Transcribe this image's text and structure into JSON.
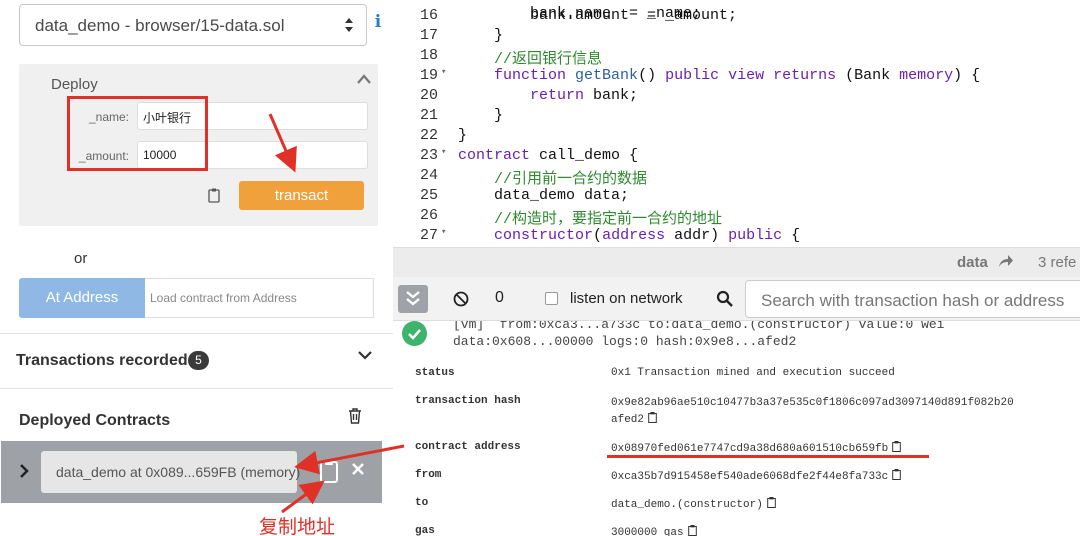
{
  "left": {
    "contract_select": "data_demo - browser/15-data.sol",
    "deploy": {
      "title": "Deploy",
      "fields": [
        {
          "label": "_name:",
          "value": "小叶银行"
        },
        {
          "label": "_amount:",
          "value": "10000"
        }
      ],
      "transact_label": "transact"
    },
    "or_label": "or",
    "at_address": {
      "button": "At Address",
      "placeholder": "Load contract from Address"
    },
    "transactions": {
      "title": "Transactions recorded:",
      "count": "5"
    },
    "deployed": {
      "title": "Deployed Contracts",
      "instance": "data_demo at 0x089...659FB (memory)"
    },
    "annotation": "复制地址"
  },
  "editor": {
    "lines": [
      {
        "n": "16",
        "fold": false,
        "html": "        bank.amount  = _amount;"
      },
      {
        "n": "17",
        "fold": false,
        "html": "    }"
      },
      {
        "n": "18",
        "fold": false,
        "html": "    <span class='cm'>//返回银行信息</span>"
      },
      {
        "n": "19",
        "fold": true,
        "html": "    <span class='kw'>function</span> <span class='fn'>getBank</span>() <span class='kw'>public view returns</span> (Bank <span class='kw'>memory</span>) {"
      },
      {
        "n": "20",
        "fold": false,
        "html": "        <span class='kw'>return</span> bank;"
      },
      {
        "n": "21",
        "fold": false,
        "html": "    }"
      },
      {
        "n": "22",
        "fold": false,
        "html": "}"
      },
      {
        "n": "23",
        "fold": true,
        "html": "<span class='kw'>contract</span> call_demo {"
      },
      {
        "n": "24",
        "fold": false,
        "html": "    <span class='cm'>//引用前一合约的数据</span>"
      },
      {
        "n": "25",
        "fold": false,
        "html": "    data_demo data;"
      },
      {
        "n": "26",
        "fold": false,
        "html": "    <span class='cm'>//构造时，要指定前一合约的地址</span>"
      },
      {
        "n": "27",
        "fold": true,
        "html": "    <span class='kw'>constructor</span>(<span class='kw'>address</span> addr) <span class='kw'>public</span> {"
      }
    ],
    "partial_top_line": "        bank.name  = _name;"
  },
  "terminal": {
    "ref_name": "data",
    "refs_label": "3 refe",
    "pending_count": "0",
    "listen_label": "listen on network",
    "search_placeholder": "Search with transaction hash or address",
    "tx_summary_1": "[vm]  from:0xca3...a733c to:data_demo.(constructor) value:0 wei",
    "tx_summary_2": "data:0x608...00000 logs:0 hash:0x9e8...afed2",
    "details": [
      {
        "key": "status",
        "value": "0x1 Transaction mined and execution succeed"
      },
      {
        "key": "transaction hash",
        "value": "0x9e82ab96ae510c10477b3a37e535c0f1806c097ad3097140d891f082b20\nafed2"
      },
      {
        "key": "contract address",
        "value": "0x08970fed061e7747cd9a38d680a601510cb659fb"
      },
      {
        "key": "from",
        "value": "0xca35b7d915458ef540ade6068dfe2f44e8fa733c"
      },
      {
        "key": "to",
        "value": "data_demo.(constructor)"
      },
      {
        "key": "gas",
        "value": "3000000 gas"
      }
    ]
  },
  "colors": {
    "accent_orange": "#f0a13c",
    "annotation_red": "#e03128",
    "success_green": "#3db36b"
  }
}
